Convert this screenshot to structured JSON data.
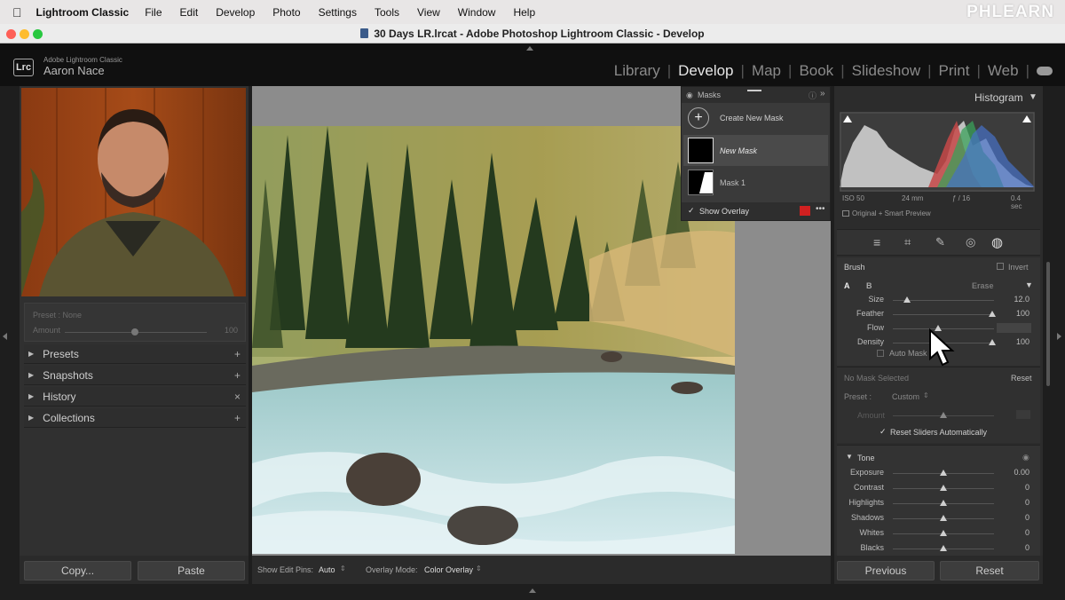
{
  "menubar": {
    "app_name": "Lightroom Classic",
    "items": [
      "File",
      "Edit",
      "Develop",
      "Photo",
      "Settings",
      "Tools",
      "View",
      "Window",
      "Help"
    ],
    "watermark": "PHLEARN"
  },
  "window": {
    "title": "30 Days LR.lrcat - Adobe Photoshop Lightroom Classic - Develop"
  },
  "lr_header": {
    "app_label": "Adobe Lightroom Classic",
    "user_name": "Aaron Nace",
    "logo": "Lrc",
    "modules": [
      "Library",
      "Develop",
      "Map",
      "Book",
      "Slideshow",
      "Print",
      "Web"
    ],
    "active_module": "Develop"
  },
  "left_panel": {
    "preset_label": "Preset : None",
    "amount_label": "Amount",
    "amount_value": "100",
    "sections": [
      {
        "label": "Presets",
        "action": "+"
      },
      {
        "label": "Snapshots",
        "action": "+"
      },
      {
        "label": "History",
        "action": "×"
      },
      {
        "label": "Collections",
        "action": "+"
      }
    ],
    "copy_button": "Copy...",
    "paste_button": "Paste"
  },
  "masks_panel": {
    "title": "Masks",
    "create_new": "Create New Mask",
    "masks": [
      {
        "name": "New Mask",
        "selected": true
      },
      {
        "name": "Mask 1",
        "selected": false
      }
    ],
    "show_overlay_label": "Show Overlay",
    "overlay_color": "#d02020"
  },
  "toolbar": {
    "show_edit_pins_label": "Show Edit Pins:",
    "show_edit_pins_value": "Auto",
    "overlay_mode_label": "Overlay Mode:",
    "overlay_mode_value": "Color Overlay"
  },
  "right_panel": {
    "histogram_title": "Histogram",
    "camera_info": {
      "iso": "ISO 50",
      "focal": "24 mm",
      "aperture": "ƒ / 16",
      "shutter": "0.4 sec"
    },
    "preview_label": "Original + Smart Preview",
    "brush": {
      "title": "Brush",
      "invert_label": "Invert",
      "tab_a": "A",
      "tab_b": "B",
      "erase_label": "Erase",
      "auto_mask_label": "Auto Mask",
      "sliders": [
        {
          "label": "Size",
          "value": "12.0",
          "pos": 0.14
        },
        {
          "label": "Feather",
          "value": "100",
          "pos": 0.98
        },
        {
          "label": "Flow",
          "value": "45",
          "pos": 0.45
        },
        {
          "label": "Density",
          "value": "100",
          "pos": 0.98
        }
      ]
    },
    "no_mask_label": "No Mask Selected",
    "reset_label": "Reset",
    "preset_label": "Preset :",
    "preset_value": "Custom",
    "amount_label": "Amount",
    "reset_sliders_label": "Reset Sliders Automatically",
    "tone": {
      "title": "Tone",
      "sliders": [
        {
          "label": "Exposure",
          "value": "0.00",
          "pos": 0.5
        },
        {
          "label": "Contrast",
          "value": "0",
          "pos": 0.5
        },
        {
          "label": "Highlights",
          "value": "0",
          "pos": 0.5
        },
        {
          "label": "Shadows",
          "value": "0",
          "pos": 0.5
        },
        {
          "label": "Whites",
          "value": "0",
          "pos": 0.5
        },
        {
          "label": "Blacks",
          "value": "0",
          "pos": 0.5
        }
      ]
    },
    "previous_button": "Previous",
    "reset_button": "Reset"
  }
}
